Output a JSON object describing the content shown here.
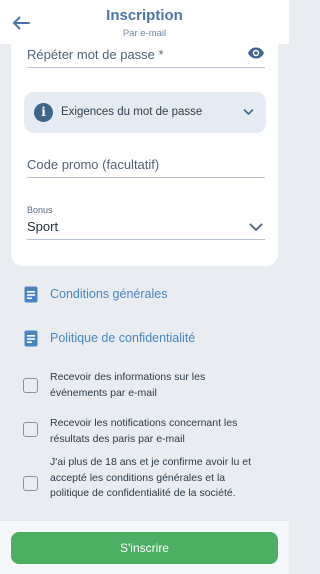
{
  "header": {
    "title": "Inscription",
    "subtitle": "Par e-mail",
    "back_icon": "arrow-left-icon"
  },
  "form": {
    "password_confirm": {
      "placeholder": "Répéter mot de passe *",
      "icon": "eye-icon"
    },
    "password_requirements": {
      "label": "Exigences du mot de passe",
      "icon": "info-icon",
      "expand_icon": "chevron-down-icon"
    },
    "promo_code": {
      "placeholder": "Code promo (facultatif)"
    },
    "bonus": {
      "label": "Bonus",
      "value": "Sport",
      "icon": "chevron-down-icon"
    }
  },
  "links": [
    {
      "label": "Conditions générales",
      "icon": "document-icon"
    },
    {
      "label": "Politique de confidentialité",
      "icon": "document-icon"
    }
  ],
  "checkboxes": [
    {
      "label": "Recevoir des informations sur les événements par e-mail",
      "checked": false
    },
    {
      "label": "Recevoir les notifications concernant les résultats des paris par e-mail",
      "checked": false
    },
    {
      "label": "J'ai plus de 18 ans et je confirme avoir lu et accepté les conditions générales et la politique de confidentialité de la société.",
      "checked": false
    }
  ],
  "submit": {
    "label": "S'inscrire"
  },
  "colors": {
    "accent": "#4a76a8",
    "link": "#4a85c0",
    "submit_button": "#4caf63",
    "background": "#e9edf2"
  }
}
